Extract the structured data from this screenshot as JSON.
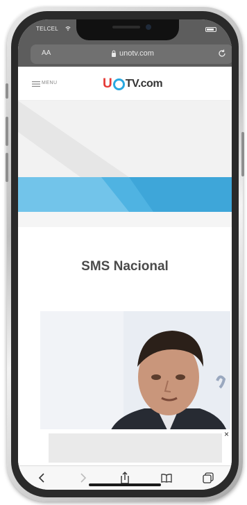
{
  "status_bar": {
    "carrier": "TELCEL"
  },
  "browser": {
    "text_size": "AA",
    "url": "unotv.com"
  },
  "site_header": {
    "menu_label": "MENU",
    "logo_text": "TV.com",
    "logo_prefix": "U"
  },
  "section": {
    "title": "SMS Nacional"
  },
  "ad": {
    "close_label": "×"
  },
  "toolbar": {
    "back": "back-icon",
    "forward": "forward-icon",
    "share": "share-icon",
    "bookmarks": "book-icon",
    "tabs": "tabs-icon"
  },
  "colors": {
    "accent_blue": "#29a8e0",
    "accent_red": "#e53935",
    "browser_chrome": "#5d5d5d"
  }
}
